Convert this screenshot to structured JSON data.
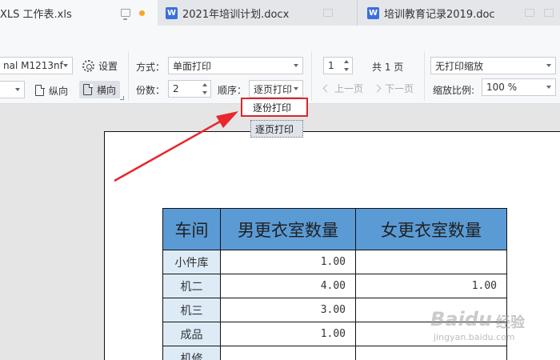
{
  "tabs": [
    {
      "label": "XLS 工作表.xls",
      "active": true
    },
    {
      "label": "2021年培训计划.docx",
      "icon": "word-doc-icon"
    },
    {
      "label": "培训教育记录2019.doc",
      "icon": "word-doc-icon"
    }
  ],
  "word_icon_letter": "W",
  "toolbar": {
    "printer_value": "nal M1213nf",
    "settings_label": "设置",
    "portrait_label": "纵向",
    "landscape_label": "横向",
    "mode_label": "方式：",
    "mode_value": "单面打印",
    "copies_label": "份数：",
    "copies_value": "2",
    "order_label": "顺序：",
    "order_value": "逐页打印",
    "page_value": "1",
    "total_pages": "共 1 页",
    "prev_page": "上一页",
    "next_page": "下一页",
    "scaling_value": "无打印缩放",
    "zoom_label": "缩放比例:",
    "zoom_value": "100 %"
  },
  "order_dropdown": {
    "options": [
      "逐份打印",
      "逐页打印"
    ],
    "highlighted": "逐份打印",
    "selected": "逐页打印"
  },
  "annotation": {
    "arrow_color": "#e8272e"
  },
  "colors": {
    "header_blue": "#5b9bd5",
    "name_cell": "#ddebf7",
    "highlight_red": "#d9262c",
    "tab_dot": "#f5a623"
  },
  "table": {
    "headers": [
      "车间",
      "男更衣室数量",
      "女更衣室数量"
    ],
    "rows": [
      [
        "小件库",
        "1.00",
        ""
      ],
      [
        "机二",
        "4.00",
        "1.00"
      ],
      [
        "机三",
        "3.00",
        ""
      ],
      [
        "成品",
        "1.00",
        ""
      ],
      [
        "机修",
        "",
        ""
      ]
    ]
  },
  "watermark": {
    "logo": "Baidu",
    "cn": "经验",
    "url": "jingyan.baidu.com"
  }
}
